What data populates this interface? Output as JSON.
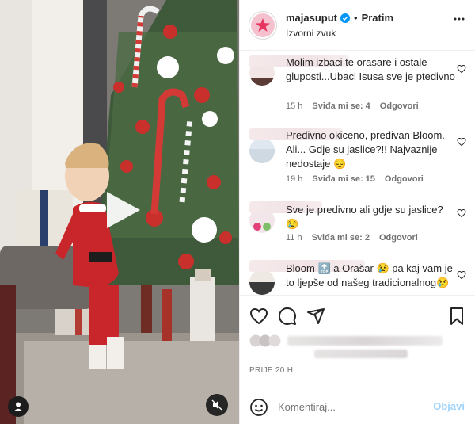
{
  "post": {
    "username": "majasuput",
    "follow_label": "Pratim",
    "dot": "•",
    "audio": "Izvorni zvuk",
    "timestamp": "PRIJE 20 H"
  },
  "comments": [
    {
      "text": "Molim izbaci te orasare i ostale gluposti...Ubaci Isusa sve je ptedivno",
      "time": "15 h",
      "likes": "Sviđa mi se: 4",
      "reply": "Odgovori"
    },
    {
      "text": "Predivno okiceno, predivan Bloom. Ali... Gdje su jaslice?!! Najvaznije nedostaje 😔",
      "time": "19 h",
      "likes": "Sviđa mi se: 15",
      "reply": "Odgovori"
    },
    {
      "text": "Sve je predivno ali gdje su jaslice?😢",
      "time": "11 h",
      "likes": "Sviđa mi se: 2",
      "reply": "Odgovori"
    },
    {
      "text": "Bloom 🔝 a Orašar 😢 pa kaj vam je to ljepše od našeg tradicionalnog😢",
      "time": "",
      "likes": "",
      "reply": ""
    }
  ],
  "composer": {
    "placeholder": "Komentiraj...",
    "post_label": "Objavi"
  },
  "icons": {
    "like": "heart-icon",
    "comment": "comment-icon",
    "share": "send-icon",
    "save": "bookmark-icon",
    "emoji": "emoji-icon",
    "more": "more-options-icon",
    "play": "play-icon",
    "mute": "muted-speaker-icon",
    "tags": "user-tag-icon"
  },
  "colors": {
    "accent_blue": "#0095f6",
    "post_disabled": "#9fd3fb",
    "secondary_text": "#737373",
    "verified": "#0095f6"
  }
}
